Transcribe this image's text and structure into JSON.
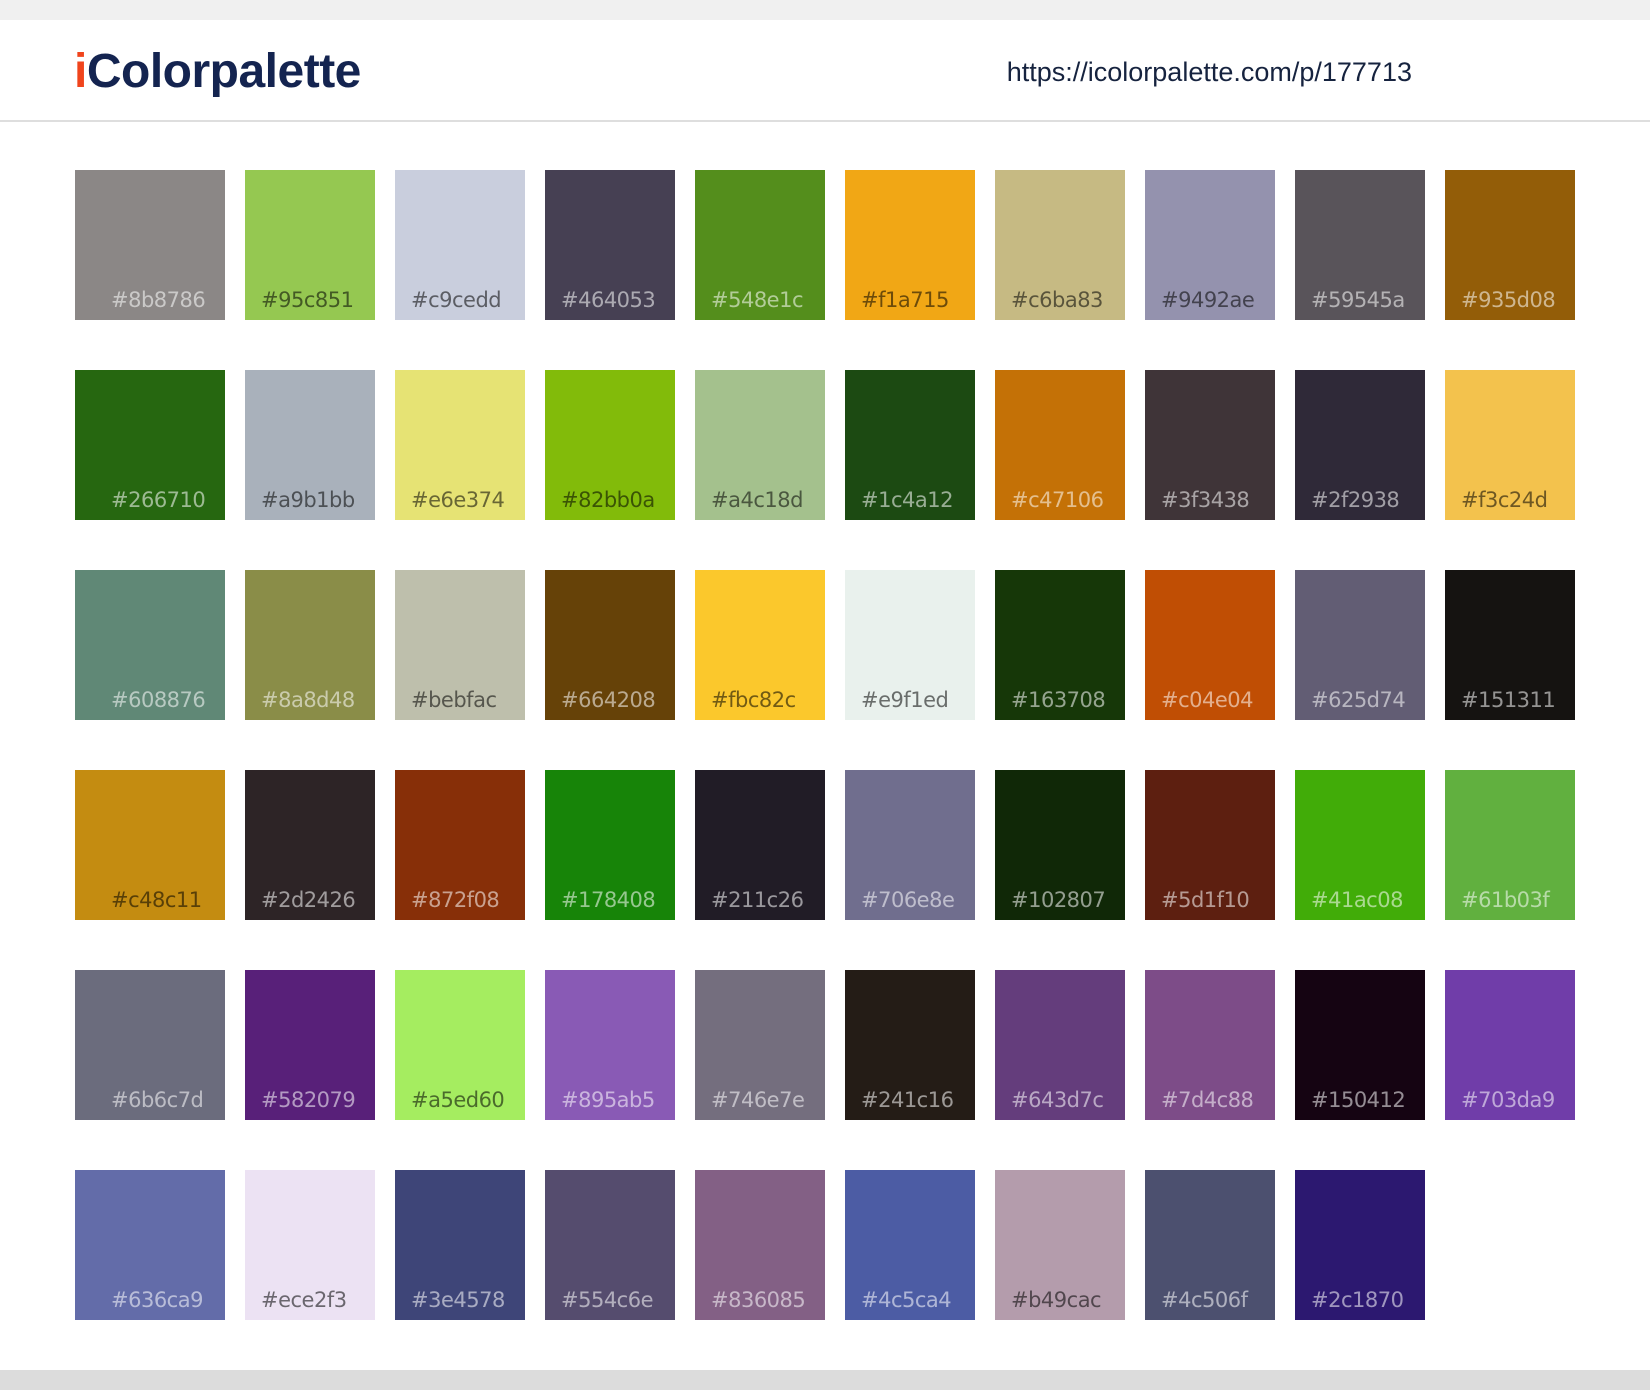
{
  "header": {
    "logo_first": "i",
    "logo_rest": "Colorpalette",
    "url": "https://icolorpalette.com/p/177713"
  },
  "palette": [
    {
      "hex": "#8b8786",
      "label": "#8b8786"
    },
    {
      "hex": "#95c851",
      "label": "#95c851"
    },
    {
      "hex": "#c9cedd",
      "label": "#c9cedd"
    },
    {
      "hex": "#464053",
      "label": "#464053"
    },
    {
      "hex": "#548e1c",
      "label": "#548e1c"
    },
    {
      "hex": "#f1a715",
      "label": "#f1a715"
    },
    {
      "hex": "#c6ba83",
      "label": "#c6ba83"
    },
    {
      "hex": "#9492ae",
      "label": "#9492ae"
    },
    {
      "hex": "#59545a",
      "label": "#59545a"
    },
    {
      "hex": "#935d08",
      "label": "#935d08"
    },
    {
      "hex": "#266710",
      "label": "#266710"
    },
    {
      "hex": "#a9b1bb",
      "label": "#a9b1bb"
    },
    {
      "hex": "#e6e374",
      "label": "#e6e374"
    },
    {
      "hex": "#82bb0a",
      "label": "#82bb0a"
    },
    {
      "hex": "#a4c18d",
      "label": "#a4c18d"
    },
    {
      "hex": "#1c4a12",
      "label": "#1c4a12"
    },
    {
      "hex": "#c47106",
      "label": "#c47106"
    },
    {
      "hex": "#3f3438",
      "label": "#3f3438"
    },
    {
      "hex": "#2f2938",
      "label": "#2f2938"
    },
    {
      "hex": "#f3c24d",
      "label": "#f3c24d"
    },
    {
      "hex": "#608876",
      "label": "#608876"
    },
    {
      "hex": "#8a8d48",
      "label": "#8a8d48"
    },
    {
      "hex": "#bebfac",
      "label": "#bebfac"
    },
    {
      "hex": "#664208",
      "label": "#664208"
    },
    {
      "hex": "#fbc82c",
      "label": "#fbc82c"
    },
    {
      "hex": "#e9f1ed",
      "label": "#e9f1ed"
    },
    {
      "hex": "#163708",
      "label": "#163708"
    },
    {
      "hex": "#c04e04",
      "label": "#c04e04"
    },
    {
      "hex": "#625d74",
      "label": "#625d74"
    },
    {
      "hex": "#151311",
      "label": "#151311"
    },
    {
      "hex": "#c48c11",
      "label": "#c48c11"
    },
    {
      "hex": "#2d2426",
      "label": "#2d2426"
    },
    {
      "hex": "#872f08",
      "label": "#872f08"
    },
    {
      "hex": "#178408",
      "label": "#178408"
    },
    {
      "hex": "#211c26",
      "label": "#211c26"
    },
    {
      "hex": "#706e8e",
      "label": "#706e8e"
    },
    {
      "hex": "#102807",
      "label": "#102807"
    },
    {
      "hex": "#5d1f10",
      "label": "#5d1f10"
    },
    {
      "hex": "#41ac08",
      "label": "#41ac08"
    },
    {
      "hex": "#61b03f",
      "label": "#61b03f"
    },
    {
      "hex": "#6b6c7d",
      "label": "#6b6c7d"
    },
    {
      "hex": "#582079",
      "label": "#582079"
    },
    {
      "hex": "#a5ed60",
      "label": "#a5ed60"
    },
    {
      "hex": "#895ab5",
      "label": "#895ab5"
    },
    {
      "hex": "#746e7e",
      "label": "#746e7e"
    },
    {
      "hex": "#241c16",
      "label": "#241c16"
    },
    {
      "hex": "#643d7c",
      "label": "#643d7c"
    },
    {
      "hex": "#7d4c88",
      "label": "#7d4c88"
    },
    {
      "hex": "#150412",
      "label": "#150412"
    },
    {
      "hex": "#703da9",
      "label": "#703da9"
    },
    {
      "hex": "#636ca9",
      "label": "#636ca9"
    },
    {
      "hex": "#ece2f3",
      "label": "#ece2f3"
    },
    {
      "hex": "#3e4578",
      "label": "#3e4578"
    },
    {
      "hex": "#554c6e",
      "label": "#554c6e"
    },
    {
      "hex": "#836085",
      "label": "#836085"
    },
    {
      "hex": "#4c5ca4",
      "label": "#4c5ca4"
    },
    {
      "hex": "#b49cac",
      "label": "#b49cac"
    },
    {
      "hex": "#4c506f",
      "label": "#4c506f"
    },
    {
      "hex": "#2c1870",
      "label": "#2c1870"
    }
  ]
}
